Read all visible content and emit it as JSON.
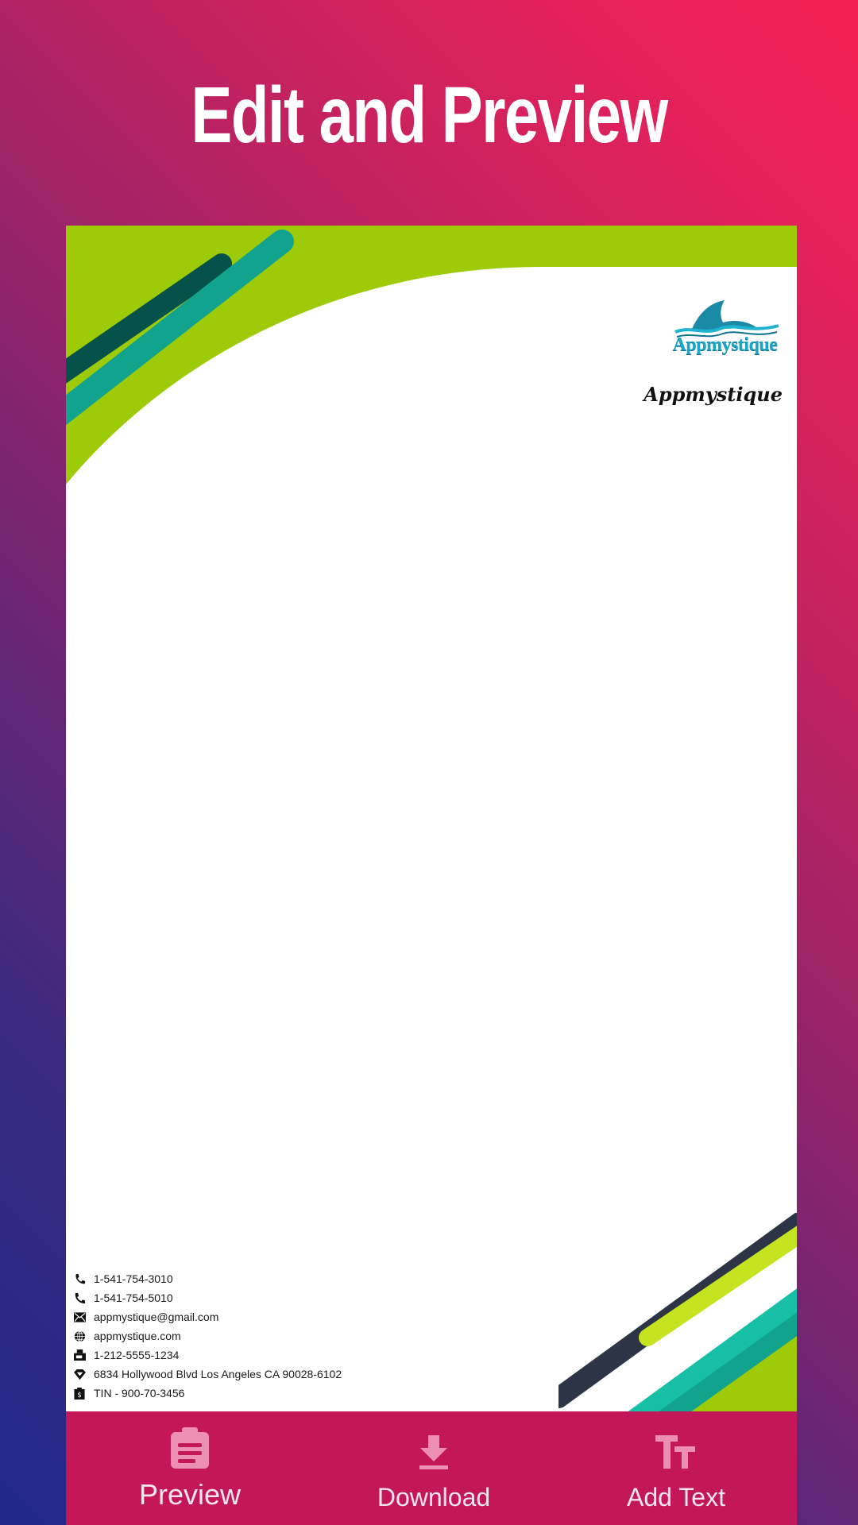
{
  "header": {
    "title": "Edit and Preview"
  },
  "letterhead": {
    "logo_text": "Appmystique",
    "company_name": "Appmystique",
    "contacts": [
      {
        "icon": "phone-icon",
        "text": "1-541-754-3010"
      },
      {
        "icon": "mobile-phone-icon",
        "text": "1-541-754-5010"
      },
      {
        "icon": "envelope-icon",
        "text": "appmystique@gmail.com"
      },
      {
        "icon": "globe-icon",
        "text": "appmystique.com"
      },
      {
        "icon": "fax-icon",
        "text": "1-212-5555-1234"
      },
      {
        "icon": "location-pin-icon",
        "text": "6834 Hollywood Blvd Los Angeles CA 90028-6102"
      },
      {
        "icon": "tax-id-icon",
        "text": "TIN - 900-70-3456"
      }
    ],
    "colors": {
      "lime": "#9dcb08",
      "teal": "#12a38e",
      "dark_teal": "#06524a",
      "navy": "#2b3545",
      "yellow_green": "#c5e31e",
      "aqua": "#17bfa6"
    }
  },
  "bottom_bar": {
    "background": "#c4175a",
    "buttons": [
      {
        "label": "Preview",
        "icon": "clipboard-icon"
      },
      {
        "label": "Download",
        "icon": "download-icon"
      },
      {
        "label": "Add Text",
        "icon": "text-size-icon"
      }
    ]
  }
}
